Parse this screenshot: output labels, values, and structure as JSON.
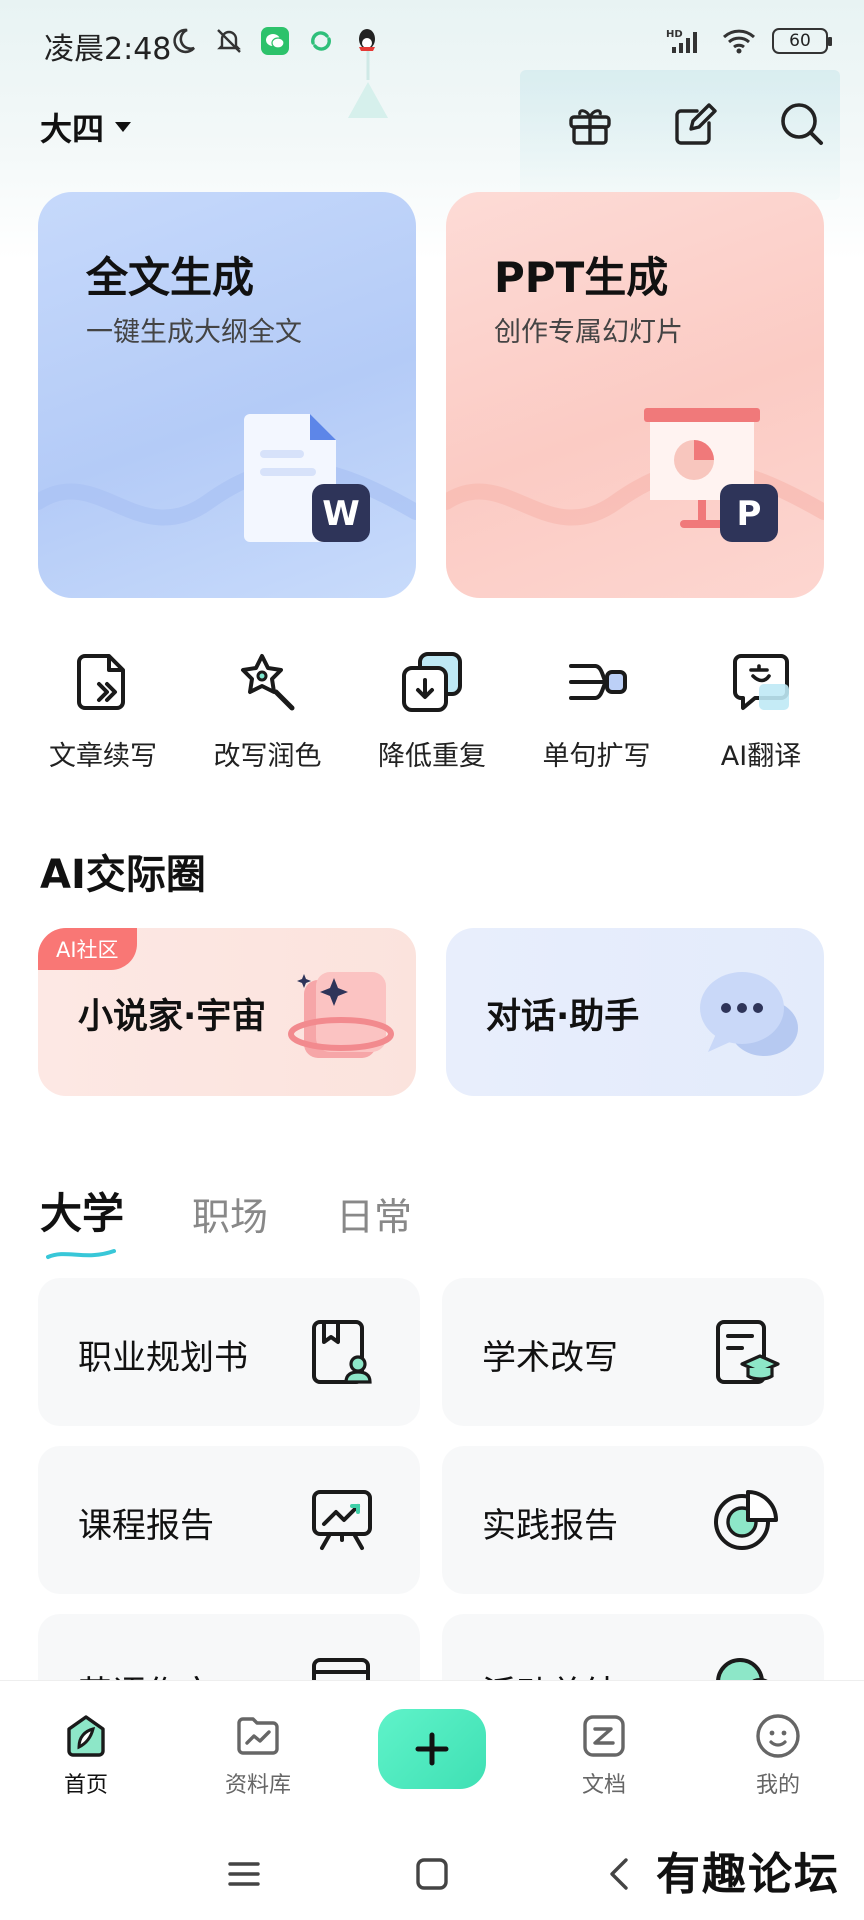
{
  "status_bar": {
    "time": "凌晨2:48",
    "battery": "60",
    "network": "HD"
  },
  "header": {
    "grade": "大四"
  },
  "big_cards": [
    {
      "title": "全文生成",
      "subtitle": "一键生成大纲全文",
      "badge": "W"
    },
    {
      "title": "PPT生成",
      "subtitle": "创作专属幻灯片",
      "badge": "P"
    }
  ],
  "tools": [
    {
      "label": "文章续写",
      "icon": "doc-continue-icon"
    },
    {
      "label": "改写润色",
      "icon": "rewrite-polish-icon"
    },
    {
      "label": "降低重复",
      "icon": "reduce-duplicate-icon"
    },
    {
      "label": "单句扩写",
      "icon": "sentence-expand-icon"
    },
    {
      "label": "AI翻译",
      "icon": "translate-icon"
    }
  ],
  "community": {
    "title": "AI交际圈",
    "cards": [
      {
        "label": "小说家·宇宙",
        "badge": "AI社区"
      },
      {
        "label": "对话·助手"
      }
    ]
  },
  "tabs": [
    {
      "label": "大学",
      "active": true
    },
    {
      "label": "职场",
      "active": false
    },
    {
      "label": "日常",
      "active": false
    }
  ],
  "templates": [
    {
      "label": "职业规划书",
      "icon": "career-plan-icon"
    },
    {
      "label": "学术改写",
      "icon": "academic-rewrite-icon"
    },
    {
      "label": "课程报告",
      "icon": "course-report-icon"
    },
    {
      "label": "实践报告",
      "icon": "practice-report-icon"
    },
    {
      "label": "英语作文",
      "icon": "english-essay-icon"
    },
    {
      "label": "活动总结",
      "icon": "activity-summary-icon"
    }
  ],
  "bottom_nav": [
    {
      "label": "首页",
      "icon": "home-leaf-icon",
      "active": true
    },
    {
      "label": "资料库",
      "icon": "library-icon",
      "active": false
    },
    {
      "label": "文档",
      "icon": "document-icon",
      "active": false
    },
    {
      "label": "我的",
      "icon": "profile-smile-icon",
      "active": false
    }
  ],
  "watermark": "有趣论坛",
  "colors": {
    "accent": "#3fe0b4",
    "doc_card": "#c6d9fb",
    "ppt_card": "#fddbd6",
    "badge_red": "#f97775"
  }
}
